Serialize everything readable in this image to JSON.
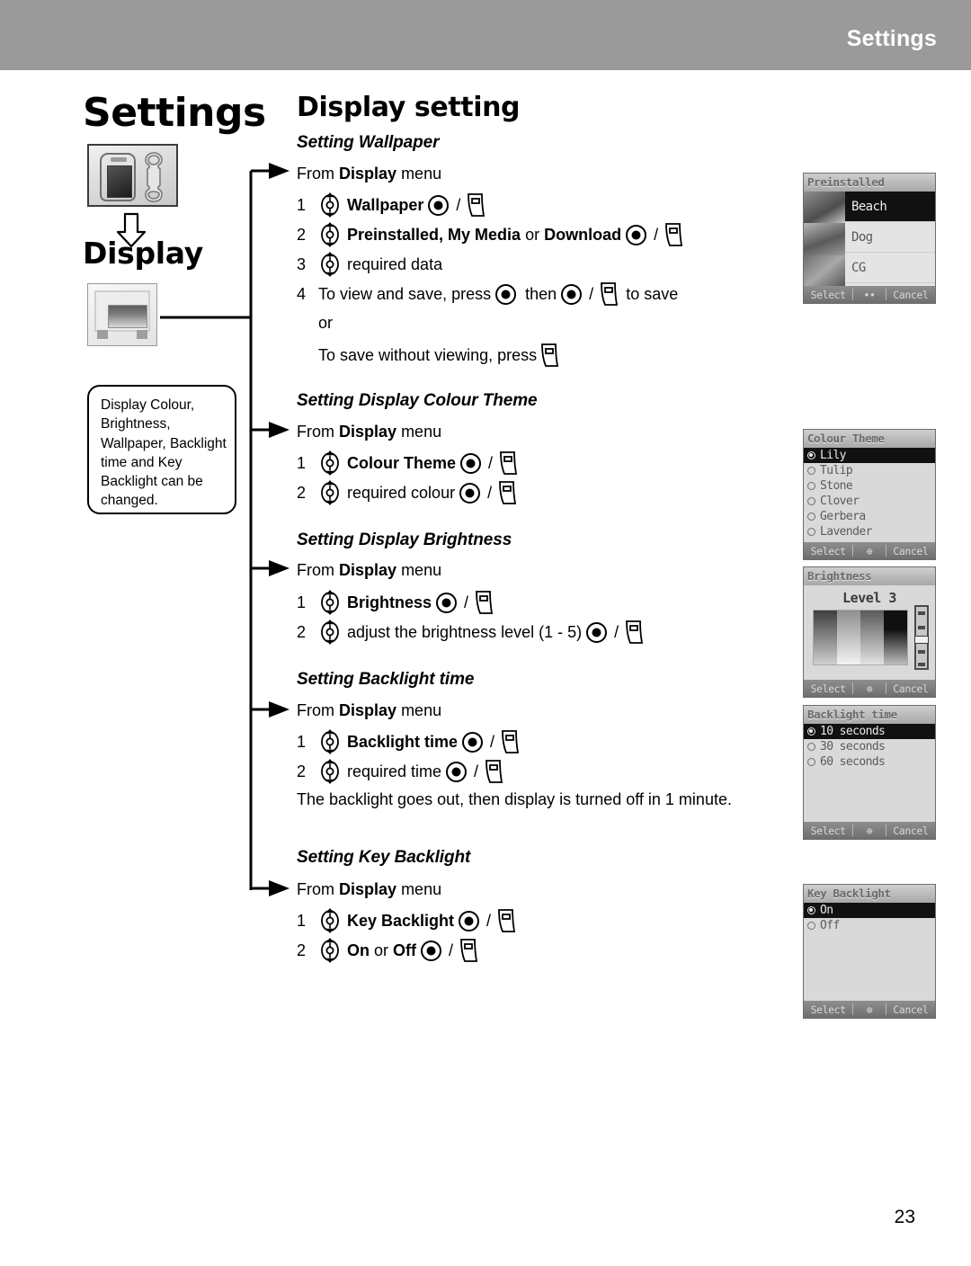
{
  "header": {
    "title": "Settings"
  },
  "sidebar": {
    "chapter_title": "Settings",
    "menu_title": "Display",
    "settings_icon": "settings-phone-wrench-icon",
    "display_icon": "display-monitor-icon",
    "arrow_icon": "down-arrow-icon",
    "note": "Display Colour, Brightness, Wallpaper, Backlight time and Key Backlight can be changed."
  },
  "main": {
    "title": "Display setting",
    "sections": [
      {
        "heading": "Setting Wallpaper",
        "from": {
          "prefix": "From",
          "bold": "Display",
          "suffix": "menu"
        },
        "steps": [
          {
            "num": "1",
            "nav": true,
            "bold": "Wallpaper",
            "plain": "",
            "select": true,
            "soft": true
          },
          {
            "num": "2",
            "nav": true,
            "bold": "Preinstalled, My Media",
            "mid": "or",
            "bold2": "Download",
            "select": true,
            "soft": true
          },
          {
            "num": "3",
            "nav": true,
            "bold": "",
            "plain": "required data",
            "select": false,
            "soft": false
          },
          {
            "num": "4",
            "nav": false,
            "plain": "To view and save, press",
            "select": true,
            "plain2": "then",
            "select2": true,
            "soft": true,
            "plain3": "to save"
          }
        ],
        "extra_or": "or",
        "extra_line": "To save without viewing, press"
      },
      {
        "heading": "Setting Display Colour Theme",
        "from": {
          "prefix": "From",
          "bold": "Display",
          "suffix": "menu"
        },
        "steps": [
          {
            "num": "1",
            "nav": true,
            "bold": "Colour Theme",
            "select": true,
            "soft": true
          },
          {
            "num": "2",
            "nav": true,
            "plain": "required colour",
            "select": true,
            "soft": true
          }
        ]
      },
      {
        "heading": "Setting Display Brightness",
        "from": {
          "prefix": "From",
          "bold": "Display",
          "suffix": "menu"
        },
        "steps": [
          {
            "num": "1",
            "nav": true,
            "bold": "Brightness",
            "select": true,
            "soft": true
          },
          {
            "num": "2",
            "nav": true,
            "plain": "adjust the brightness level (1 - 5)",
            "select": true,
            "soft": true
          }
        ]
      },
      {
        "heading": "Setting Backlight time",
        "from": {
          "prefix": "From",
          "bold": "Display",
          "suffix": "menu"
        },
        "steps": [
          {
            "num": "1",
            "nav": true,
            "bold": "Backlight time",
            "select": true,
            "soft": true
          },
          {
            "num": "2",
            "nav": true,
            "plain": "required time",
            "select": true,
            "soft": true
          }
        ],
        "note": "The backlight goes out, then display is turned off in 1 minute."
      },
      {
        "heading": "Setting Key Backlight",
        "from": {
          "prefix": "From",
          "bold": "Display",
          "suffix": "menu"
        },
        "steps": [
          {
            "num": "1",
            "nav": true,
            "bold": "Key Backlight",
            "select": true,
            "soft": true
          },
          {
            "num": "2",
            "nav": true,
            "bold": "On",
            "mid": "or",
            "bold2": "Off",
            "select": true,
            "soft": true
          }
        ]
      }
    ],
    "labels": {
      "from_prefix": "From",
      "from_bold": "Display",
      "from_suffix": "menu",
      "s1_step1_bold": "Wallpaper",
      "s1_step2_bold_a": "Preinstalled, My Media",
      "s1_step2_mid": "or",
      "s1_step2_bold_b": "Download",
      "s1_step3": "required data",
      "s1_step4_a": "To view and save, press",
      "s1_step4_b": "then",
      "s1_step4_c": "to save",
      "s1_or": "or",
      "s1_save": "To save without viewing, press",
      "s2_step1_bold": "Colour Theme",
      "s2_step2": "required colour",
      "s3_step1_bold": "Brightness",
      "s3_step2": "adjust the brightness level (1 - 5)",
      "s4_step1_bold": "Backlight time",
      "s4_step2": "required time",
      "s4_note": "The backlight goes out, then display is turned off in 1 minute.",
      "s5_step1_bold": "Key Backlight",
      "s5_step2_bold_a": "On",
      "s5_step2_mid": "or",
      "s5_step2_bold_b": "Off",
      "num1": "1",
      "num2": "2",
      "num3": "3",
      "num4": "4"
    }
  },
  "screens": {
    "wallpaper": {
      "title": "Preinstalled",
      "items": [
        "Beach",
        "Dog",
        "CG"
      ],
      "selected_index": 0,
      "softkeys": {
        "left": "Select",
        "center": "••",
        "right": "Cancel"
      }
    },
    "colour_theme": {
      "title": "Colour Theme",
      "items": [
        "Lily",
        "Tulip",
        "Stone",
        "Clover",
        "Gerbera",
        "Lavender"
      ],
      "selected_index": 0,
      "softkeys": {
        "left": "Select",
        "center": "⊕",
        "right": "Cancel"
      }
    },
    "brightness": {
      "title": "Brightness",
      "level_label": "Level 3",
      "softkeys": {
        "left": "Select",
        "center": "⊕",
        "right": "Cancel"
      }
    },
    "backlight_time": {
      "title": "Backlight time",
      "items": [
        "10 seconds",
        "30 seconds",
        "60 seconds"
      ],
      "selected_index": 0,
      "softkeys": {
        "left": "Select",
        "center": "⊕",
        "right": "Cancel"
      }
    },
    "key_backlight": {
      "title": "Key Backlight",
      "items": [
        "On",
        "Off"
      ],
      "selected_index": 0,
      "softkeys": {
        "left": "Select",
        "center": "⊕",
        "right": "Cancel"
      }
    }
  },
  "footer": {
    "page_number": "23"
  },
  "icons": {
    "nav": "navigation-joystick-icon",
    "select": "center-select-key-icon",
    "soft": "soft-key-icon",
    "branch_arrow": "branch-arrow-icon"
  },
  "colors": {
    "header_band": "#9a9a9a",
    "header_text": "#ffffff",
    "text": "#000000",
    "screen_bg": "#d9d9d9",
    "screen_selected": "#111111"
  }
}
